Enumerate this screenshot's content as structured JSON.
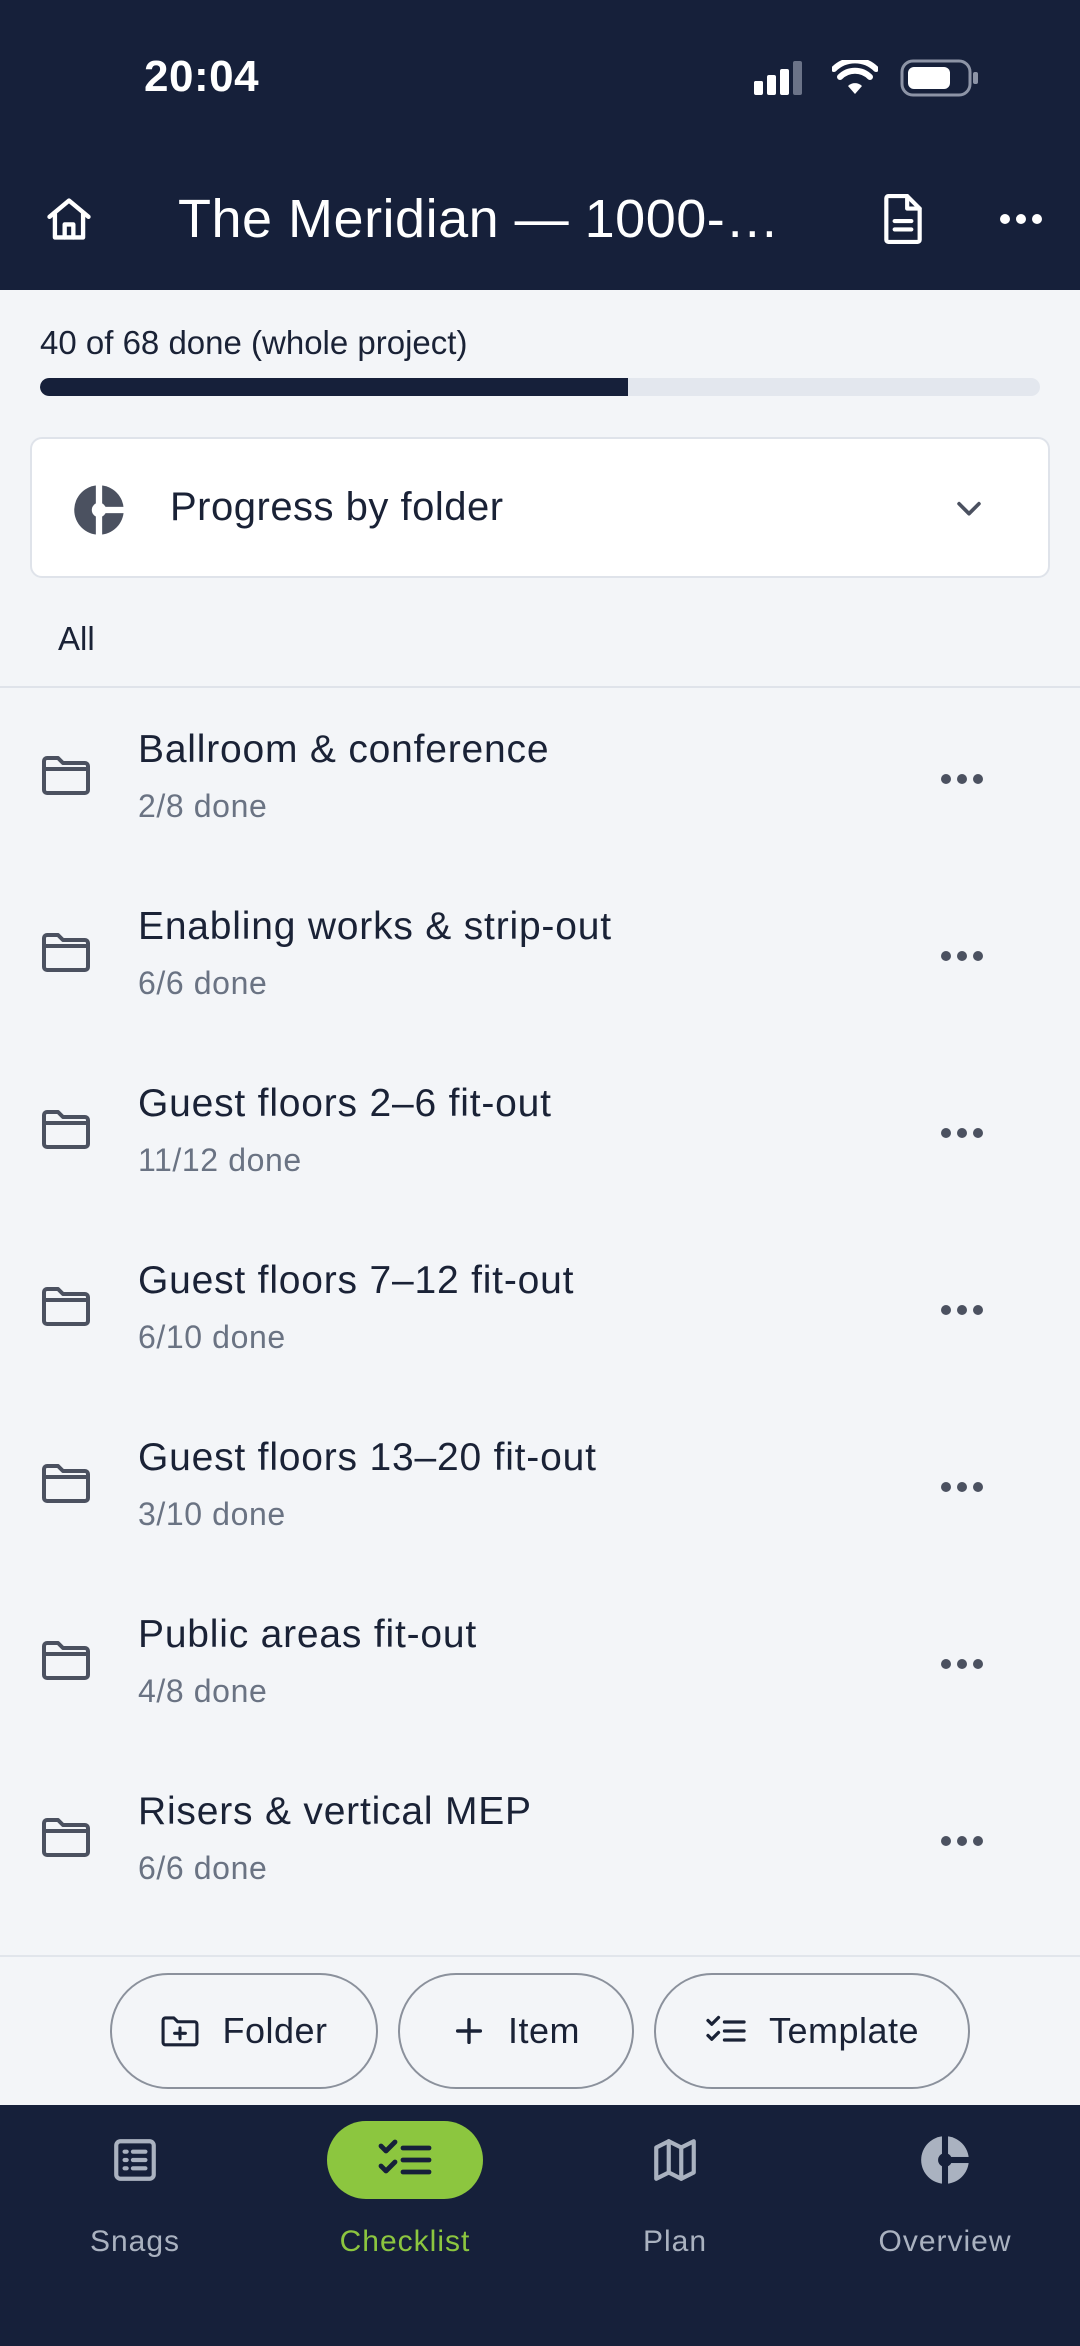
{
  "status_bar": {
    "time": "20:04"
  },
  "header": {
    "title": "The Meridian — 1000-…"
  },
  "summary": {
    "text": "40 of 68 done (whole project)",
    "done": 40,
    "total": 68
  },
  "folder_card": {
    "label": "Progress by folder"
  },
  "breadcrumb": {
    "label": "All"
  },
  "folders": [
    {
      "name": "Ballroom & conference",
      "count": "2/8 done"
    },
    {
      "name": "Enabling works & strip-out",
      "count": "6/6 done"
    },
    {
      "name": "Guest floors 2–6 fit-out",
      "count": "11/12 done"
    },
    {
      "name": "Guest floors 7–12 fit-out",
      "count": "6/10 done"
    },
    {
      "name": "Guest floors 13–20 fit-out",
      "count": "3/10 done"
    },
    {
      "name": "Public areas fit-out",
      "count": "4/8 done"
    },
    {
      "name": "Risers & vertical MEP",
      "count": "6/6 done"
    }
  ],
  "actions": {
    "folder_label": "Folder",
    "item_label": "Item",
    "template_label": "Template"
  },
  "nav": {
    "items": [
      {
        "label": "Snags",
        "icon": "list-icon"
      },
      {
        "label": "Checklist",
        "icon": "checklist-icon",
        "active": true
      },
      {
        "label": "Plan",
        "icon": "map-icon"
      },
      {
        "label": "Overview",
        "icon": "pie-chart-icon"
      }
    ]
  },
  "colors": {
    "header_bg": "#16203a",
    "accent": "#8cc63f",
    "progress_fill": "#16203a",
    "progress_track": "#e3e7ee"
  }
}
